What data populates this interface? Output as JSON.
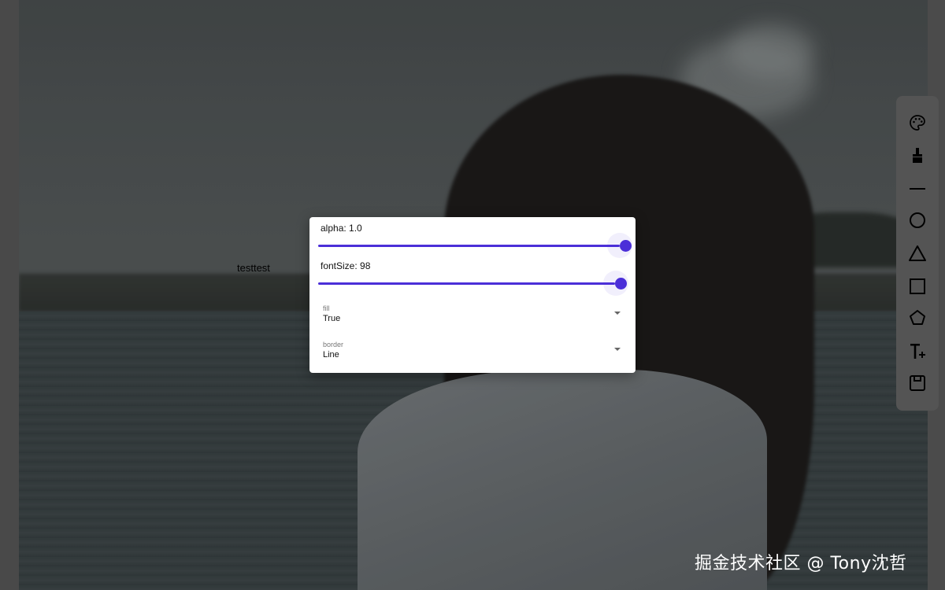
{
  "canvas": {
    "text": "testtest"
  },
  "dialog": {
    "alpha": {
      "label": "alpha: 1.0",
      "value": 1.0
    },
    "font_size": {
      "label": "fontSize: 98",
      "value": 98
    },
    "fill": {
      "caption": "fill",
      "value": "True"
    },
    "border": {
      "caption": "border",
      "value": "Line"
    }
  },
  "toolbar": {
    "items": [
      {
        "icon": "palette-icon"
      },
      {
        "icon": "brush-icon"
      },
      {
        "icon": "line-icon"
      },
      {
        "icon": "circle-icon"
      },
      {
        "icon": "triangle-icon"
      },
      {
        "icon": "square-icon"
      },
      {
        "icon": "pentagon-icon"
      },
      {
        "icon": "add-text-icon"
      },
      {
        "icon": "save-icon"
      }
    ]
  },
  "watermark": "掘金技术社区 @ Tony沈哲",
  "colors": {
    "accent": "#4b2fd8",
    "toolbar_bg": "#545454"
  }
}
